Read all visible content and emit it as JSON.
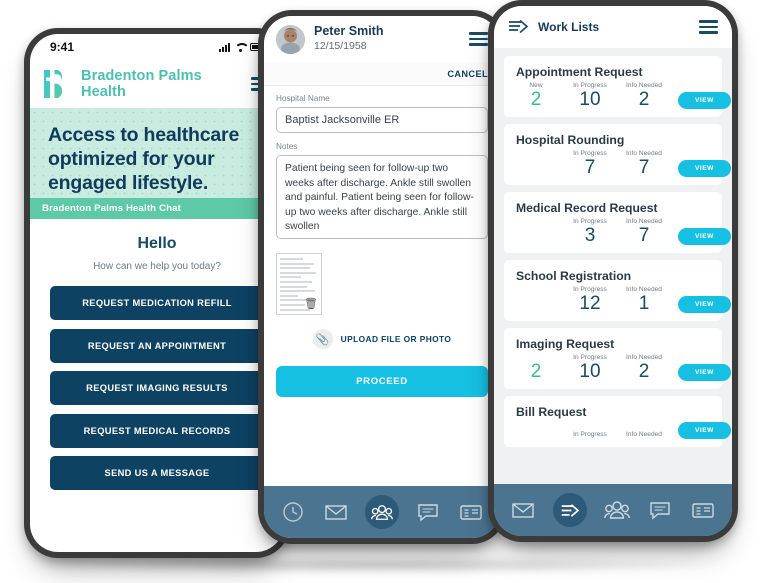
{
  "phone1": {
    "status_bar": {
      "time": "9:41",
      "signal_icon": "cellular-bars-icon",
      "wifi_icon": "wifi-icon",
      "battery_icon": "battery-icon"
    },
    "brand": {
      "name": "Bradenton Palms\nHealth",
      "line1": "Bradenton Palms",
      "line2": "Health",
      "logo_icon": "b-logo-icon",
      "accent": "#4dbfb1"
    },
    "menu_icon": "hamburger-menu-icon",
    "hero": {
      "headline": "Access to healthcare optimized for your engaged lifestyle.",
      "bg": "#c9ece1",
      "text_color": "#123a5c"
    },
    "chat_bar": {
      "title": "Bradenton Palms Health Chat",
      "minimize_label": "—",
      "bg": "#5ec9a7"
    },
    "chat": {
      "greeting": "Hello",
      "subtitle": "How can we help you today?",
      "buttons": [
        "REQUEST MEDICATION REFILL",
        "REQUEST AN APPOINTMENT",
        "REQUEST IMAGING RESULTS",
        "REQUEST MEDICAL RECORDS",
        "SEND US A MESSAGE"
      ],
      "button_color": "#0d4263"
    }
  },
  "phone2": {
    "header": {
      "patient_name": "Peter Smith",
      "patient_dob": "12/15/1958",
      "avatar_icon": "patient-avatar",
      "menu_icon": "hamburger-menu-icon"
    },
    "cancel_label": "CANCEL",
    "form": {
      "hospital": {
        "label": "Hospital Name",
        "value": "Baptist Jacksonville ER",
        "placeholder": "Hospital Name"
      },
      "notes": {
        "label": "Notes",
        "value": "Patient being seen for follow-up two weeks after discharge. Ankle still swollen and painful. Patient being seen for follow-up two weeks after discharge. Ankle still swollen",
        "placeholder": "Notes"
      },
      "attachment": {
        "name": "document-thumbnail",
        "delete_icon": "trash-icon"
      },
      "upload_label": "UPLOAD FILE OR PHOTO",
      "upload_icon": "paperclip-icon",
      "proceed_label": "PROCEED",
      "proceed_color": "#16c0e3"
    },
    "tabbar": {
      "bg": "#4a7490",
      "items": [
        {
          "icon": "clock-icon",
          "label": "History",
          "active": false
        },
        {
          "icon": "envelope-icon",
          "label": "Messages",
          "active": false
        },
        {
          "icon": "people-group-icon",
          "label": "Patients",
          "active": true
        },
        {
          "icon": "chat-bubble-icon",
          "label": "Chat",
          "active": false
        },
        {
          "icon": "id-card-icon",
          "label": "Records",
          "active": false
        }
      ]
    }
  },
  "phone3": {
    "header": {
      "title": "Work Lists",
      "title_icon": "work-lists-arrow-icon",
      "menu_icon": "hamburger-menu-icon"
    },
    "column_labels": {
      "new": "New",
      "in_progress": "In Progress",
      "info_needed": "Info Needed"
    },
    "view_label": "VIEW",
    "work_lists": [
      {
        "title": "Appointment Request",
        "new": "2",
        "in_progress": "10",
        "info_needed": "2"
      },
      {
        "title": "Hospital Rounding",
        "new": "",
        "in_progress": "7",
        "info_needed": "7"
      },
      {
        "title": "Medical Record Request",
        "new": "",
        "in_progress": "3",
        "info_needed": "7"
      },
      {
        "title": "School Registration",
        "new": "",
        "in_progress": "12",
        "info_needed": "1"
      },
      {
        "title": "Imaging Request",
        "new": "2",
        "in_progress": "10",
        "info_needed": "2"
      },
      {
        "title": "Bill Request",
        "new": "",
        "in_progress": "",
        "info_needed": ""
      }
    ],
    "tabbar": {
      "bg": "#4a7490",
      "items": [
        {
          "icon": "envelope-icon",
          "label": "Messages",
          "active": false
        },
        {
          "icon": "work-lists-arrow-icon",
          "label": "Work Lists",
          "active": true
        },
        {
          "icon": "people-group-icon",
          "label": "Patients",
          "active": false
        },
        {
          "icon": "chat-bubble-icon",
          "label": "Chat",
          "active": false
        },
        {
          "icon": "id-card-icon",
          "label": "Records",
          "active": false
        }
      ]
    }
  }
}
